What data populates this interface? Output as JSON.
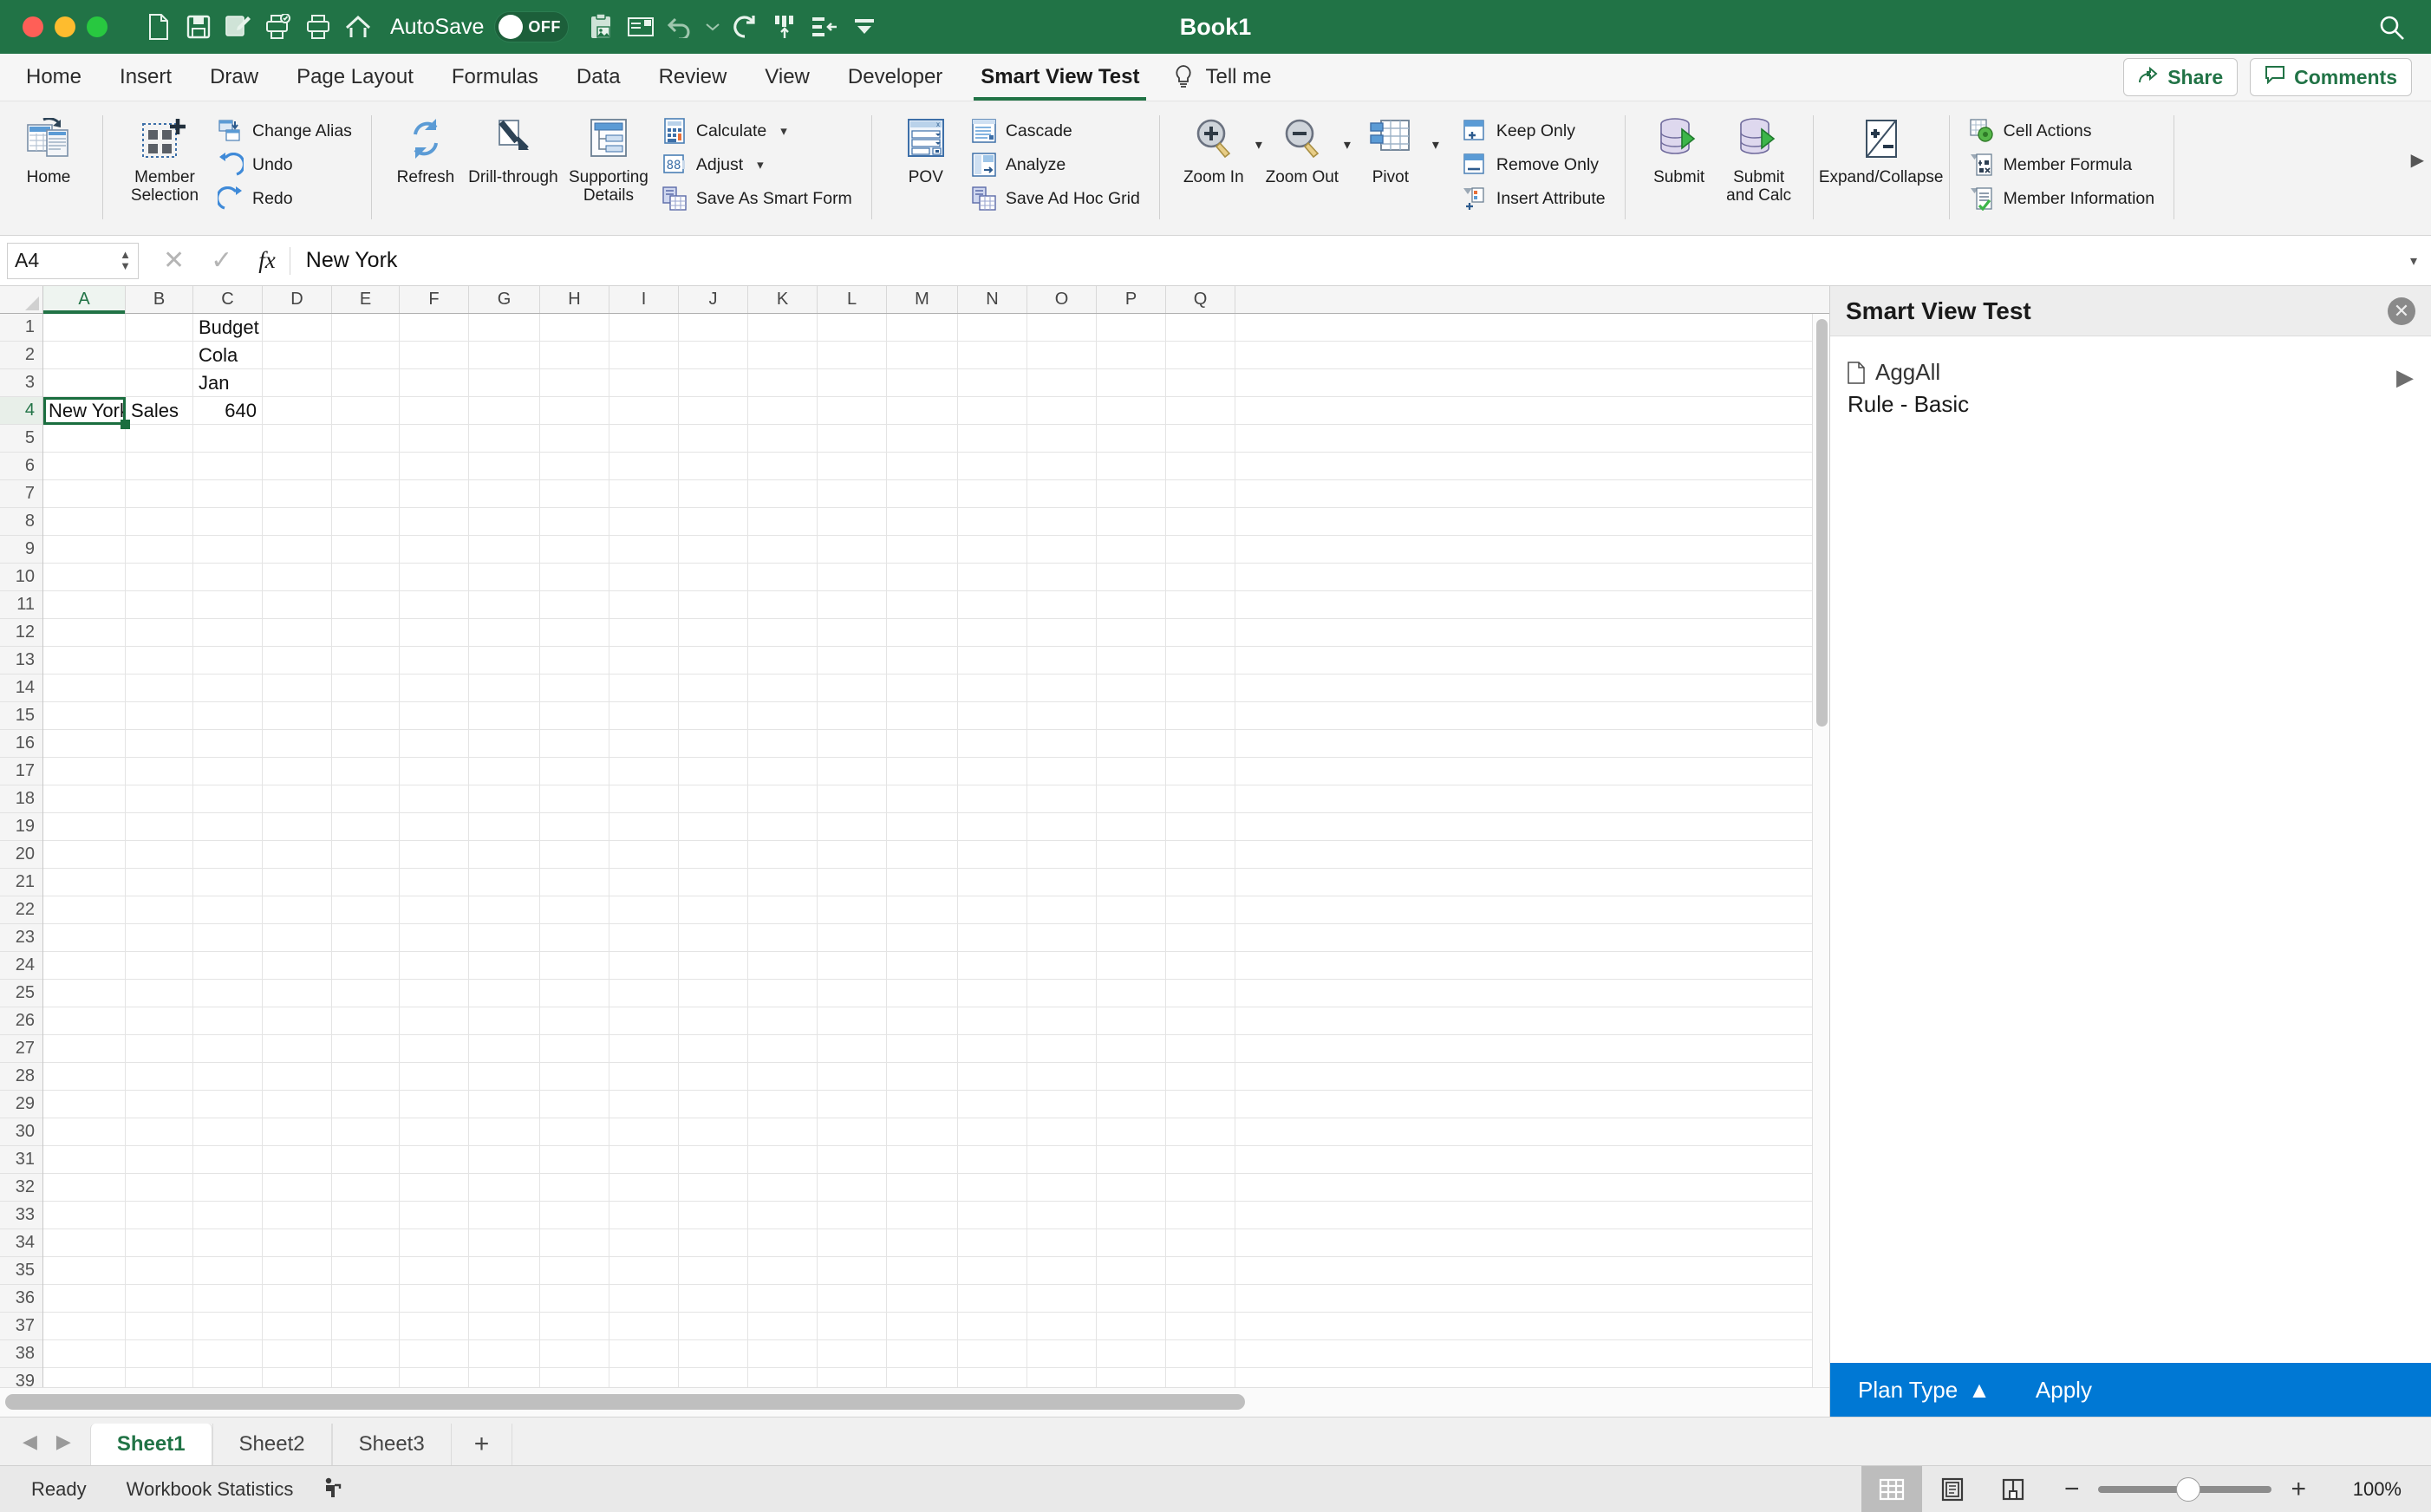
{
  "titlebar": {
    "document_title": "Book1",
    "autosave_label": "AutoSave",
    "autosave_state": "OFF",
    "quick_access": [
      {
        "name": "new-document-icon",
        "label": "New"
      },
      {
        "name": "save-icon",
        "label": "Save"
      },
      {
        "name": "save-as-icon",
        "label": "Save As"
      },
      {
        "name": "print-preview-icon",
        "label": "Print Preview"
      },
      {
        "name": "print-icon",
        "label": "Print"
      },
      {
        "name": "home-icon",
        "label": "Home"
      },
      {
        "name": "clipboard-image-icon",
        "label": "Paste Special"
      },
      {
        "name": "envelope-icon",
        "label": "Send"
      },
      {
        "name": "undo-icon",
        "label": "Undo"
      },
      {
        "name": "redo-circular-icon",
        "label": "Repeat"
      },
      {
        "name": "sort-ascending-icon",
        "label": "Sort Ascending"
      },
      {
        "name": "indent-left-icon",
        "label": "Decrease Indent"
      },
      {
        "name": "customize-qat-icon",
        "label": "Customize Quick Access Toolbar"
      }
    ],
    "search_icon": "search-icon"
  },
  "tabs": {
    "items": [
      {
        "label": "Home",
        "active": false
      },
      {
        "label": "Insert",
        "active": false
      },
      {
        "label": "Draw",
        "active": false
      },
      {
        "label": "Page Layout",
        "active": false
      },
      {
        "label": "Formulas",
        "active": false
      },
      {
        "label": "Data",
        "active": false
      },
      {
        "label": "Review",
        "active": false
      },
      {
        "label": "View",
        "active": false
      },
      {
        "label": "Developer",
        "active": false
      },
      {
        "label": "Smart View Test",
        "active": true
      }
    ],
    "tell_me": "Tell me",
    "share": "Share",
    "comments": "Comments"
  },
  "ribbon": {
    "home_button": "Home",
    "member_selection": "Member Selection",
    "change_alias": "Change Alias",
    "undo": "Undo",
    "redo": "Redo",
    "refresh": "Refresh",
    "drill_through": "Drill-through",
    "supporting_details": "Supporting Details",
    "calculate": "Calculate",
    "adjust": "Adjust",
    "save_as_smart_form": "Save As Smart Form",
    "pov": "POV",
    "cascade": "Cascade",
    "analyze": "Analyze",
    "save_ad_hoc_grid": "Save Ad Hoc Grid",
    "zoom_in": "Zoom In",
    "zoom_out": "Zoom Out",
    "pivot": "Pivot",
    "keep_only": "Keep Only",
    "remove_only": "Remove Only",
    "insert_attribute": "Insert Attribute",
    "submit": "Submit",
    "submit_and_calc": "Submit and Calc",
    "expand_collapse": "Expand/Collapse",
    "cell_actions": "Cell Actions",
    "member_formula": "Member Formula",
    "member_information": "Member Information"
  },
  "formula_bar": {
    "name_box": "A4",
    "cancel_icon": "cancel-icon",
    "accept_icon": "accept-icon",
    "fx_icon": "fx-icon",
    "value": "New York"
  },
  "grid": {
    "columns": [
      "A",
      "B",
      "C",
      "D",
      "E",
      "F",
      "G",
      "H",
      "I",
      "J",
      "K",
      "L",
      "M",
      "N",
      "O",
      "P",
      "Q"
    ],
    "selected_column": "A",
    "selected_row": 4,
    "row_count": 39,
    "cells": [
      {
        "row": 1,
        "col": "C",
        "value": "Budget",
        "align": "left"
      },
      {
        "row": 2,
        "col": "C",
        "value": "Cola",
        "align": "left"
      },
      {
        "row": 3,
        "col": "C",
        "value": "Jan",
        "align": "left"
      },
      {
        "row": 4,
        "col": "A",
        "value": "New York",
        "align": "left"
      },
      {
        "row": 4,
        "col": "B",
        "value": "Sales",
        "align": "left"
      },
      {
        "row": 4,
        "col": "C",
        "value": "640",
        "align": "right"
      }
    ]
  },
  "side_panel": {
    "title": "Smart View Test",
    "close_icon": "close-icon",
    "item": {
      "doc_icon": "document-icon",
      "name": "AggAll",
      "subtitle": "Rule - Basic",
      "expand_icon": "chevron-right-icon"
    },
    "footer": {
      "plan_type": "Plan Type",
      "plan_type_icon": "triangle-up-icon",
      "apply": "Apply",
      "accent_color": "#0078d4"
    }
  },
  "sheet_tabs": {
    "prev_icon": "prev-sheet-icon",
    "next_icon": "next-sheet-icon",
    "items": [
      {
        "label": "Sheet1",
        "active": true
      },
      {
        "label": "Sheet2",
        "active": false
      },
      {
        "label": "Sheet3",
        "active": false
      }
    ],
    "add_label": "+"
  },
  "status_bar": {
    "ready": "Ready",
    "workbook_statistics": "Workbook Statistics",
    "accessibility_icon": "accessibility-icon",
    "views": [
      {
        "name": "normal-view-icon",
        "active": true
      },
      {
        "name": "page-layout-view-icon",
        "active": false
      },
      {
        "name": "page-break-view-icon",
        "active": false
      }
    ],
    "zoom_out_label": "−",
    "zoom_in_label": "+",
    "zoom_level": "100%"
  },
  "colors": {
    "excel_green": "#217346",
    "panel_blue": "#0078d4",
    "selection_green": "#1a6e3f"
  }
}
